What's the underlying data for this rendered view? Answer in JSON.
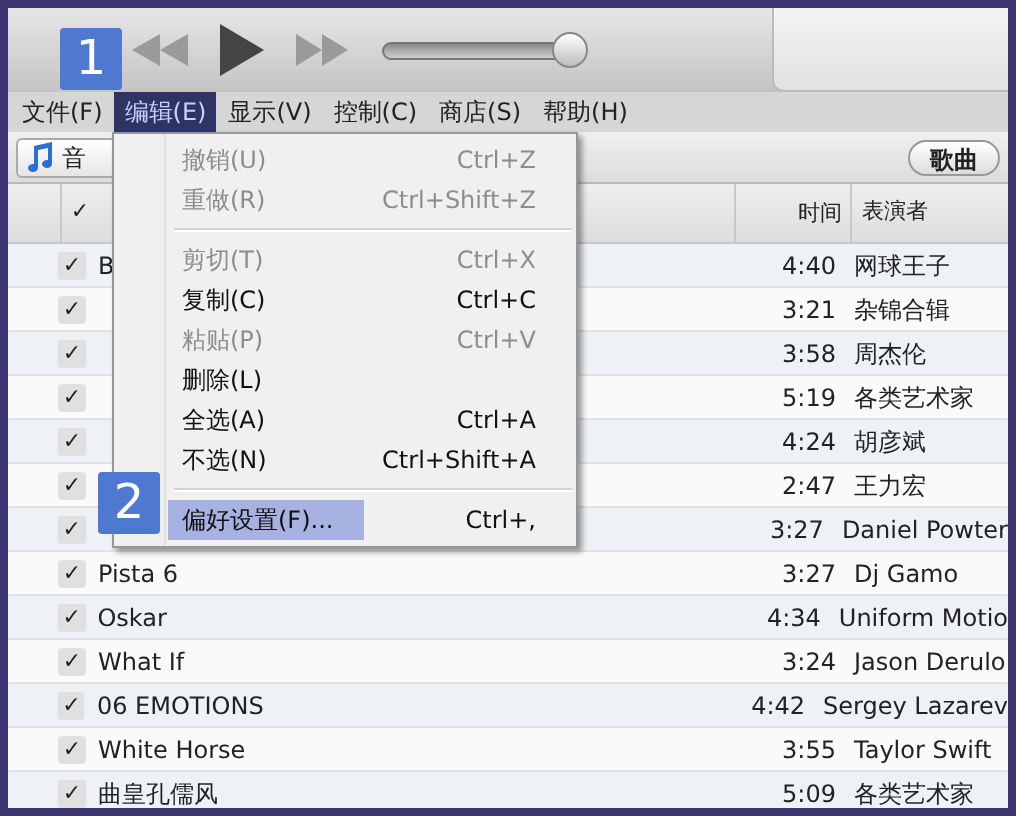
{
  "menu_bar": [
    {
      "label": "文件(F)",
      "selected": false
    },
    {
      "label": "编辑(E)",
      "selected": true
    },
    {
      "label": "显示(V)",
      "selected": false
    },
    {
      "label": "控制(C)",
      "selected": false
    },
    {
      "label": "商店(S)",
      "selected": false
    },
    {
      "label": "帮助(H)",
      "selected": false
    }
  ],
  "toolbar": {
    "volume": {
      "level": 0.92
    }
  },
  "source_button": {
    "label": "音"
  },
  "view_button": {
    "label": "歌曲"
  },
  "table": {
    "columns": [
      "✓",
      "时间",
      "表演者"
    ],
    "rows": [
      {
        "checked": true,
        "name": "B",
        "time": "4:40",
        "artist": "网球王子"
      },
      {
        "checked": true,
        "time": "3:21",
        "artist": "杂锦合辑"
      },
      {
        "checked": true,
        "time": "3:58",
        "artist": "周杰伦"
      },
      {
        "checked": true,
        "time": "5:19",
        "artist": "各类艺术家"
      },
      {
        "checked": true,
        "time": "4:24",
        "artist": "胡彦斌"
      },
      {
        "checked": true,
        "time": "2:47",
        "artist": "王力宏"
      },
      {
        "checked": true,
        "time": "3:27",
        "artist": "Daniel Powter"
      },
      {
        "checked": true,
        "name": "Pista  6",
        "time": "3:27",
        "artist": "Dj Gamo"
      },
      {
        "checked": true,
        "name": "Oskar",
        "time": "4:34",
        "artist": "Uniform Motio"
      },
      {
        "checked": true,
        "name": "What If",
        "time": "3:24",
        "artist": "Jason Derulo"
      },
      {
        "checked": true,
        "name": "06 EMOTIONS",
        "time": "4:42",
        "artist": "Sergey Lazarev"
      },
      {
        "checked": true,
        "name": "White Horse",
        "time": "3:55",
        "artist": "Taylor Swift"
      },
      {
        "checked": true,
        "name": "曲皇孔儒风",
        "time": "5:09",
        "artist": "各类艺术家"
      }
    ]
  },
  "edit_menu": {
    "items": [
      {
        "kind": "item",
        "label": "撤销(U)",
        "shortcut": "Ctrl+Z",
        "disabled": true,
        "selected": false
      },
      {
        "kind": "item",
        "label": "重做(R)",
        "shortcut": "Ctrl+Shift+Z",
        "disabled": true,
        "selected": false
      },
      {
        "kind": "separator"
      },
      {
        "kind": "item",
        "label": "剪切(T)",
        "shortcut": "Ctrl+X",
        "disabled": true,
        "selected": false
      },
      {
        "kind": "item",
        "label": "复制(C)",
        "shortcut": "Ctrl+C",
        "disabled": false,
        "selected": false
      },
      {
        "kind": "item",
        "label": "粘贴(P)",
        "shortcut": "Ctrl+V",
        "disabled": true,
        "selected": false
      },
      {
        "kind": "item",
        "label": "删除(L)",
        "disabled": false,
        "selected": false
      },
      {
        "kind": "item",
        "label": "全选(A)",
        "shortcut": "Ctrl+A",
        "disabled": false,
        "selected": false
      },
      {
        "kind": "item",
        "label": "不选(N)",
        "shortcut": "Ctrl+Shift+A",
        "disabled": false,
        "selected": false
      },
      {
        "kind": "separator"
      },
      {
        "kind": "item",
        "label": "偏好设置(F)...",
        "shortcut": "Ctrl+,",
        "disabled": false,
        "selected": true
      }
    ]
  },
  "step_badges": [
    "1",
    "2"
  ]
}
